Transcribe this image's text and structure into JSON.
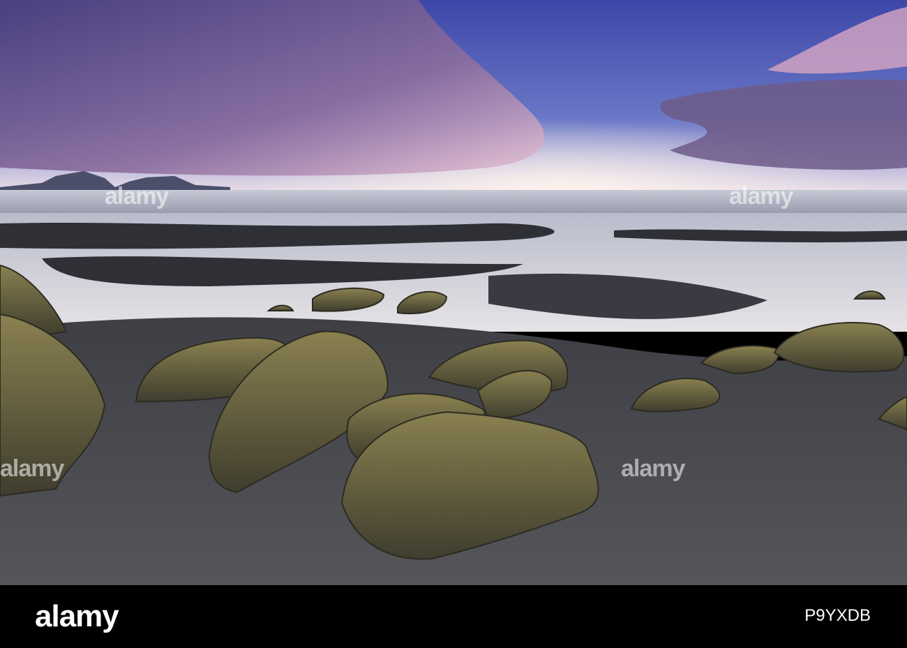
{
  "watermark": {
    "brand": "alamy",
    "image_id": "P9YXDB"
  },
  "colors": {
    "sky_top": "#4a4fa8",
    "sky_glow": "#f3e6ea",
    "cloud": "#8a6a9c",
    "sand": "#4a4a4e",
    "rock": "#5f5a3a",
    "bar": "#000000"
  }
}
